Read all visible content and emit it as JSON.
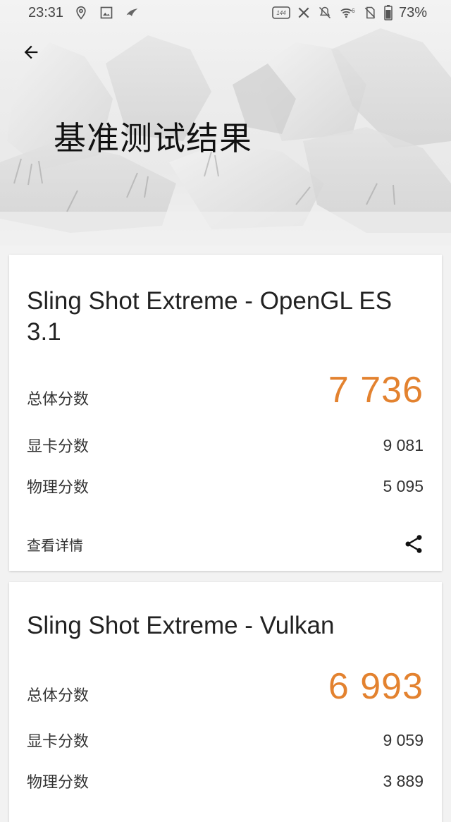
{
  "status_bar": {
    "time": "23:31",
    "refresh_badge": "144",
    "signal_badge": "6",
    "battery": "73%"
  },
  "header": {
    "title": "基准测试结果"
  },
  "results": [
    {
      "title": "Sling Shot Extreme - OpenGL ES 3.1",
      "total_label": "总体分数",
      "total_score": "7 736",
      "gpu_label": "显卡分数",
      "gpu_score": "9 081",
      "physics_label": "物理分数",
      "physics_score": "5 095",
      "details_label": "查看详情"
    },
    {
      "title": "Sling Shot Extreme - Vulkan",
      "total_label": "总体分数",
      "total_score": "6 993",
      "gpu_label": "显卡分数",
      "gpu_score": "9 059",
      "physics_label": "物理分数",
      "physics_score": "3 889"
    }
  ],
  "colors": {
    "score_accent": "#e3822f",
    "background": "#f2f2f2",
    "card": "#ffffff"
  },
  "icons": {
    "back": "arrow-left-icon",
    "share": "share-icon",
    "location": "location-pin-icon",
    "gallery": "image-icon",
    "rog": "rog-logo-icon",
    "refresh_rate": "refresh-rate-icon",
    "x": "x-icon",
    "mute": "bell-off-icon",
    "wifi": "wifi-icon",
    "no_sim": "no-sim-icon",
    "battery": "battery-icon"
  }
}
